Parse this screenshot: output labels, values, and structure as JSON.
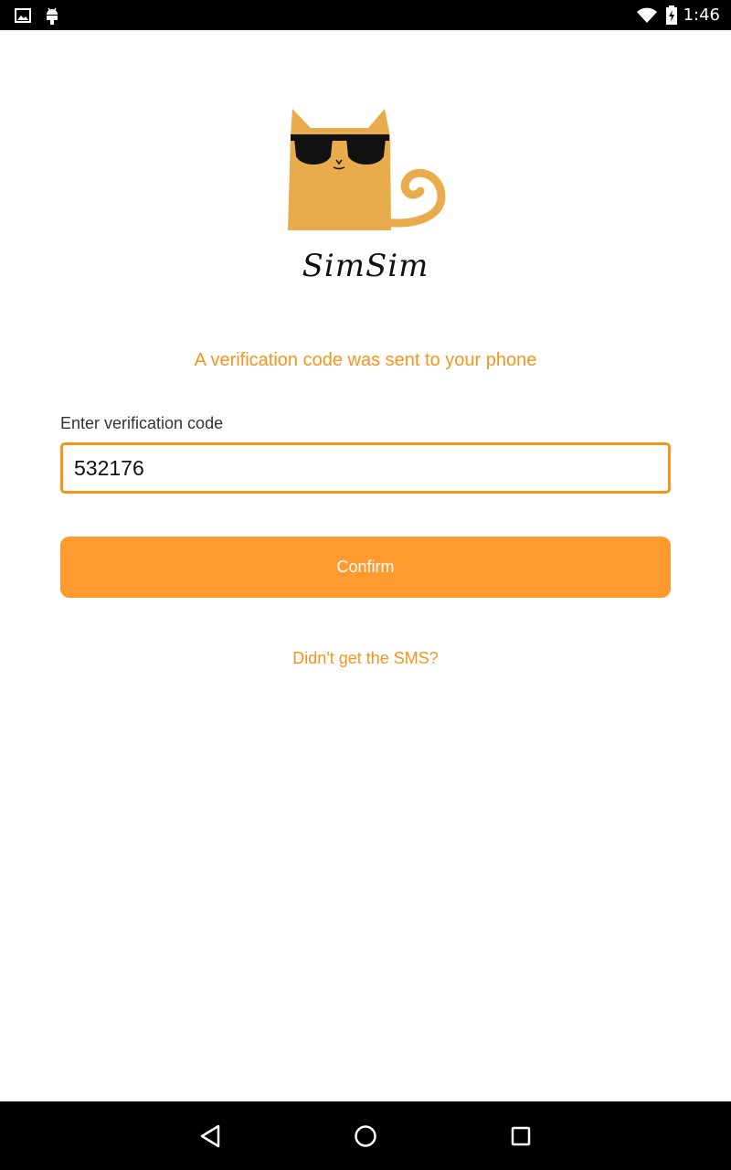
{
  "status_bar": {
    "time": "1:46",
    "left_icons": [
      "image-notification-icon",
      "android-notification-icon"
    ],
    "right_icons": [
      "wifi-icon",
      "battery-charging-icon"
    ]
  },
  "app": {
    "logo_text": "SimSim",
    "brand_color": "#f7941d"
  },
  "verification": {
    "message": "A verification code was sent to your phone",
    "field_label": "Enter verification code",
    "code_value": "532176",
    "confirm_label": "Confirm",
    "resend_link": "Didn't get the SMS?"
  },
  "nav_bar": {
    "buttons": [
      "back-icon",
      "home-icon",
      "recents-icon"
    ]
  }
}
